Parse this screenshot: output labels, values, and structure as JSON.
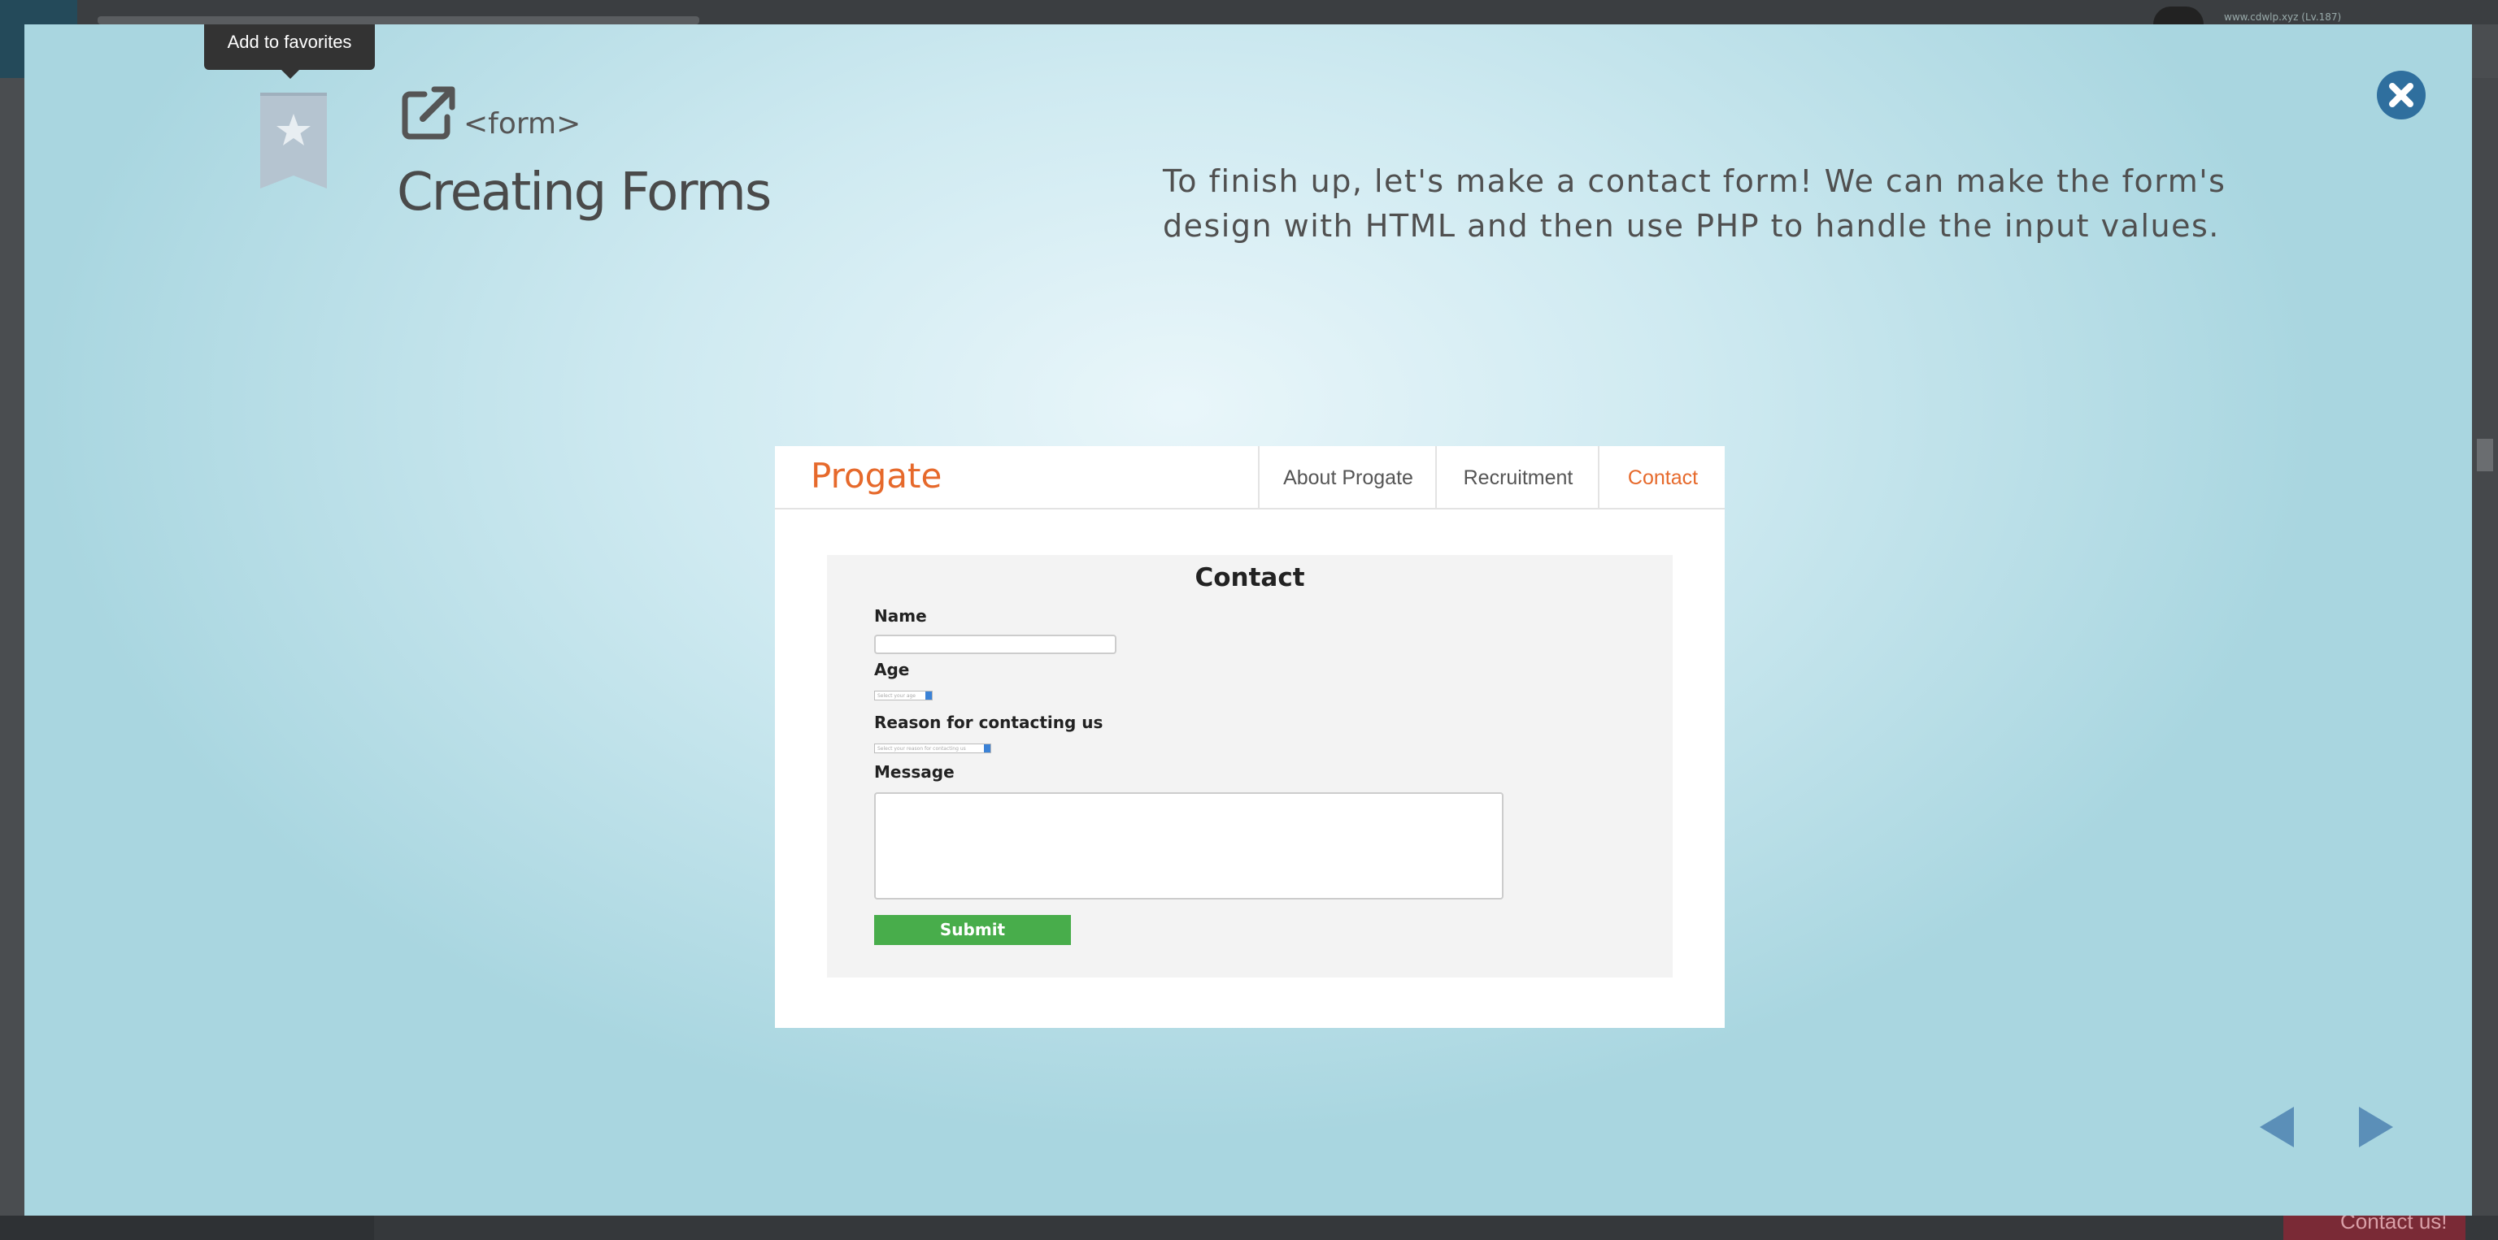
{
  "background": {
    "user_text": "www.cdwlp.xyz (Lv.187)",
    "contact_button": "Contact us!"
  },
  "tooltip": {
    "text": "Add to favorites"
  },
  "lesson": {
    "tag": "<form>",
    "title": "Creating Forms",
    "description": "To finish up, let's make a contact form! We can make the form's design with HTML and then use PHP to handle the input values."
  },
  "slide": {
    "brand": "Progate",
    "nav": [
      "About Progate",
      "Recruitment",
      "Contact"
    ],
    "panel_title": "Contact",
    "labels": {
      "name": "Name",
      "age": "Age",
      "reason": "Reason for contacting us",
      "message": "Message"
    },
    "age_placeholder": "Select your age",
    "reason_placeholder": "Select your reason for contacting us",
    "submit": "Submit"
  },
  "colors": {
    "brand_orange": "#e6692b",
    "submit_green": "#48ad4b",
    "close_blue": "#2f6f9e",
    "arrow_blue": "#5b8fb8"
  },
  "icons": [
    "star-bookmark-icon",
    "external-link-icon",
    "close-icon",
    "prev-arrow-icon",
    "next-arrow-icon"
  ]
}
